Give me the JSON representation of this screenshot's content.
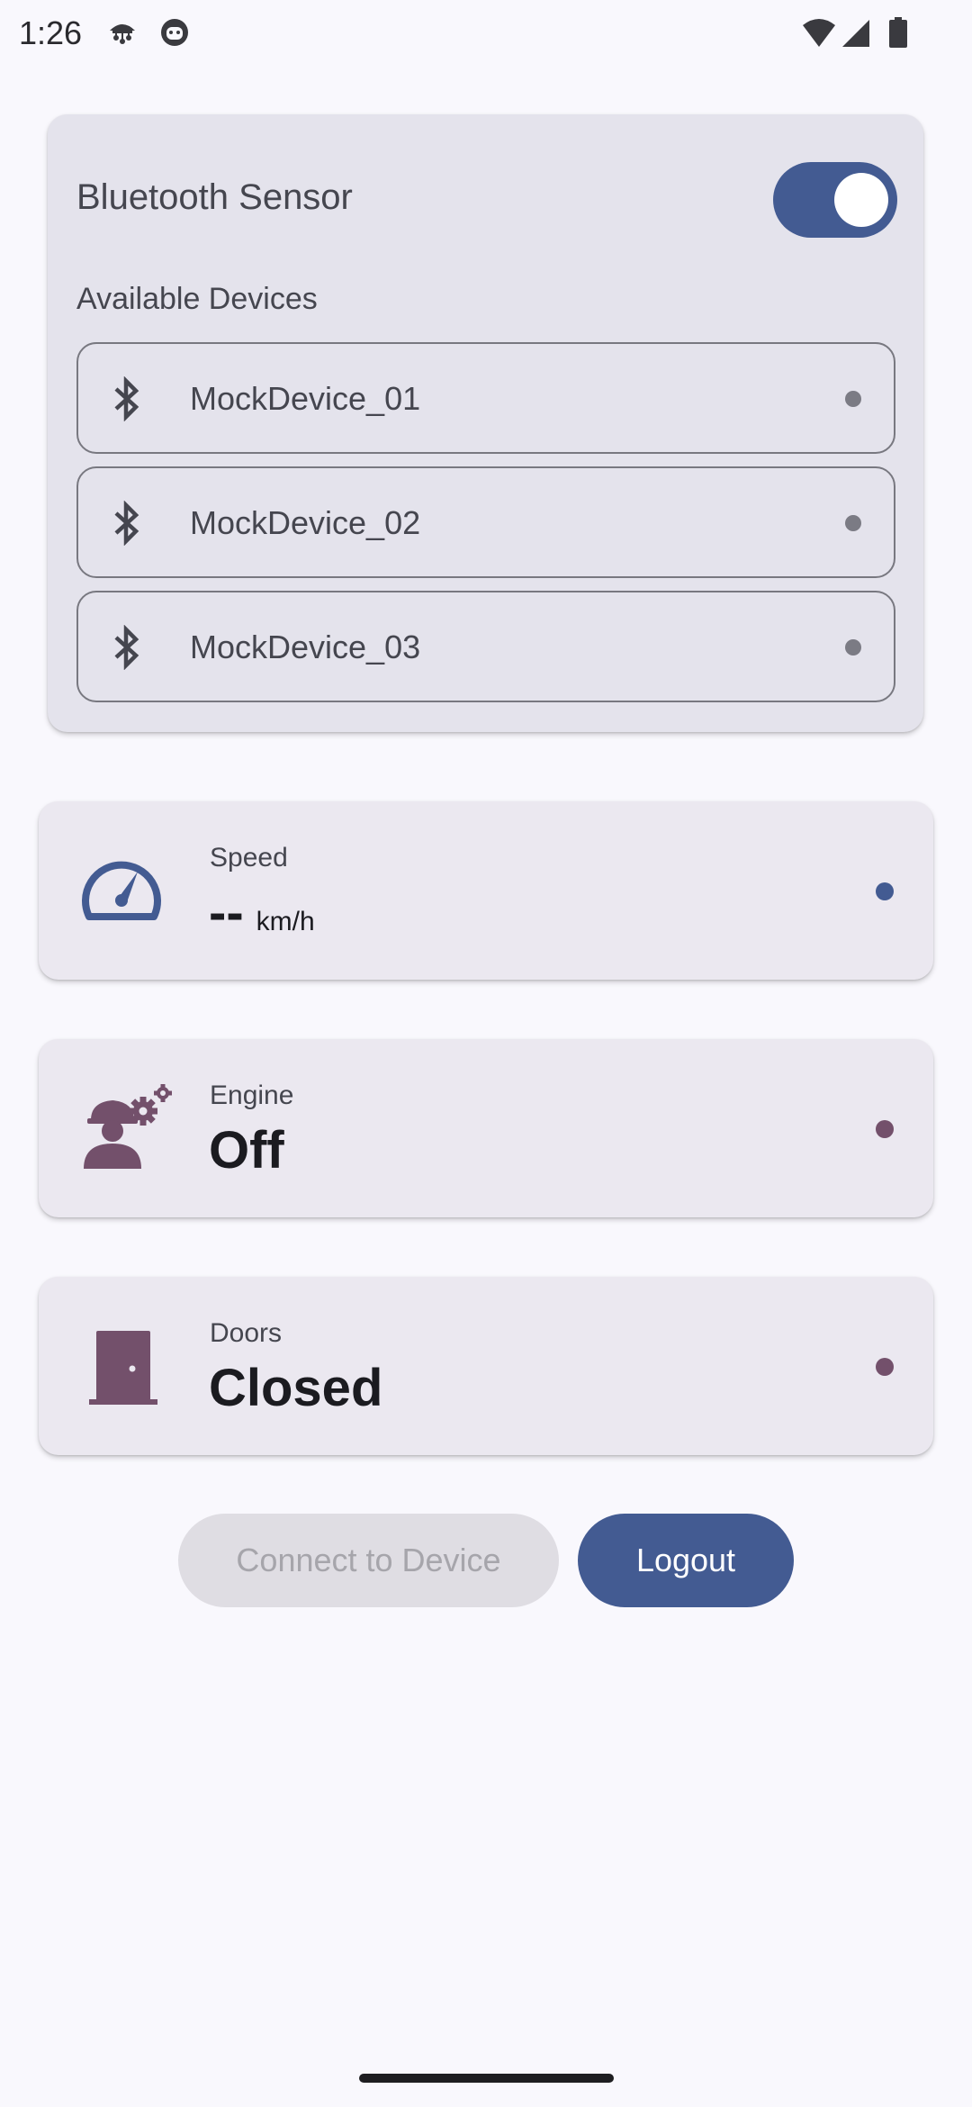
{
  "status_bar": {
    "time": "1:26",
    "icons": [
      "mushroom-notification-icon",
      "android-notification-icon",
      "wifi-icon",
      "cell-signal-icon",
      "battery-icon"
    ]
  },
  "bluetooth": {
    "title": "Bluetooth Sensor",
    "toggle_on": true,
    "devices_heading": "Available Devices",
    "devices": [
      {
        "name": "MockDevice_01",
        "icon": "bluetooth-icon"
      },
      {
        "name": "MockDevice_02",
        "icon": "bluetooth-icon"
      },
      {
        "name": "MockDevice_03",
        "icon": "bluetooth-icon"
      }
    ]
  },
  "cards": {
    "speed": {
      "label": "Speed",
      "value": "--",
      "unit": "km/h",
      "icon": "speedometer-icon",
      "dot_color": "#435b92"
    },
    "engine": {
      "label": "Engine",
      "value": "Off",
      "icon": "engineer-gear-icon",
      "dot_color": "#73506b"
    },
    "doors": {
      "label": "Doors",
      "value": "Closed",
      "icon": "door-icon",
      "dot_color": "#73506b"
    }
  },
  "actions": {
    "connect_label": "Connect to Device",
    "logout_label": "Logout"
  },
  "colors": {
    "primary": "#435b92",
    "tertiary": "#73506b",
    "background": "#f9f8fd",
    "card": "#ebe8f0"
  }
}
